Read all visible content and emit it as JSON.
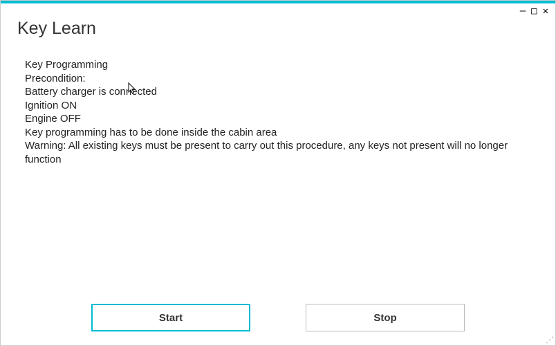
{
  "window": {
    "title": "Key Learn",
    "controls": {
      "minimize": "–",
      "maximize": "□",
      "close": "✕"
    }
  },
  "content": {
    "lines": [
      "Key Programming",
      "Precondition:",
      "Battery charger is connected",
      "Ignition ON",
      "Engine OFF",
      "Key programming has to be done inside the cabin area",
      "Warning: All existing keys must be present to carry out this procedure, any keys not present will no longer function"
    ]
  },
  "buttons": {
    "start": "Start",
    "stop": "Stop"
  }
}
